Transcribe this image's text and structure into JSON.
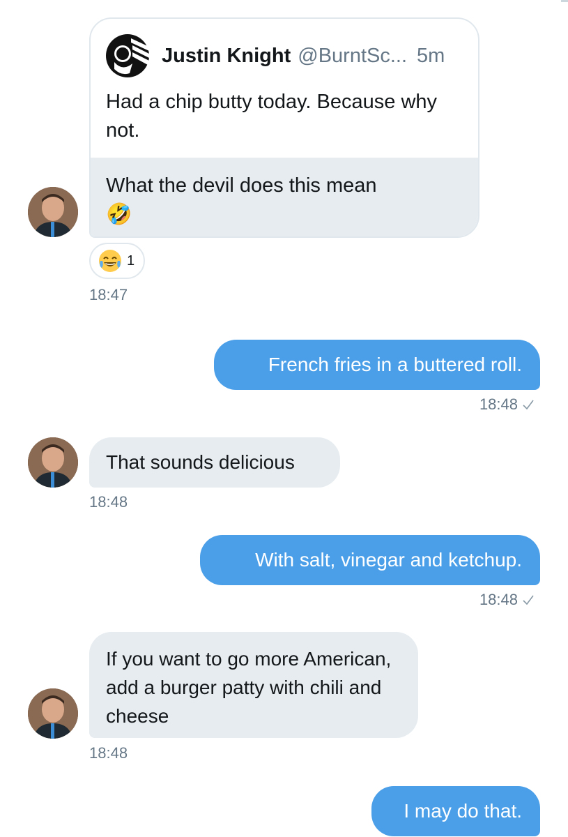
{
  "shared_tweet": {
    "author_name": "Justin Knight",
    "author_handle": "@BurntSc...",
    "age": "5m",
    "text": "Had a chip butty today. Because why not.",
    "comment": "What the devil does this mean",
    "comment_emoji": "🤣"
  },
  "reaction": {
    "emoji": "joy-emoji",
    "count": "1"
  },
  "messages": [
    {
      "direction": "in",
      "text": "",
      "time": "18:47"
    },
    {
      "direction": "out",
      "text": "French fries in a buttered roll.",
      "time": "18:48"
    },
    {
      "direction": "in",
      "text": "That sounds delicious",
      "time": "18:48"
    },
    {
      "direction": "out",
      "text": "With salt, vinegar and ketchup.",
      "time": "18:48"
    },
    {
      "direction": "in",
      "text": "If you want to go more American, add a burger patty with chili and cheese",
      "time": "18:48"
    },
    {
      "direction": "out",
      "text": "I may do that.",
      "time": ""
    }
  ],
  "colors": {
    "outgoing_bubble": "#4a9fe8",
    "incoming_bubble": "#e6ecf0",
    "timestamp": "#657786"
  }
}
